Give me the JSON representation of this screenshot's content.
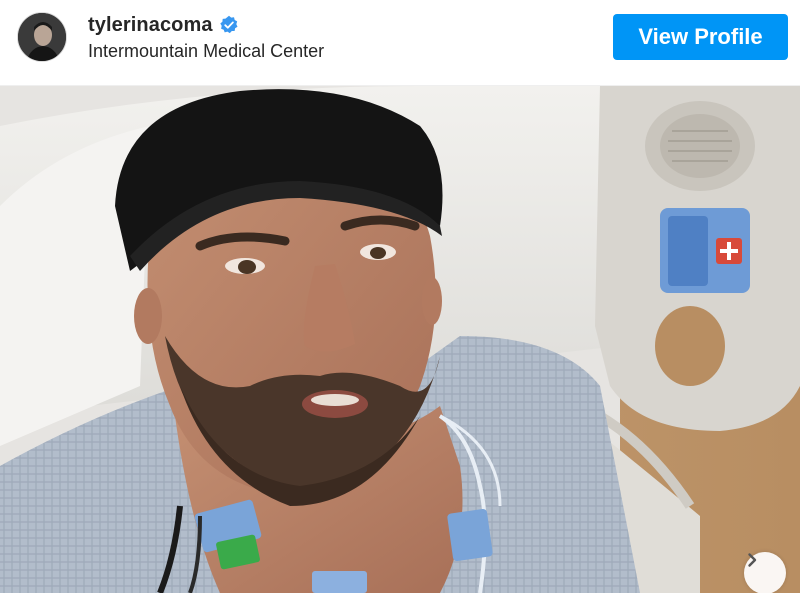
{
  "post_header": {
    "username": "tylerinacoma",
    "verified": true,
    "location": "Intermountain Medical Center",
    "view_profile_label": "View Profile"
  },
  "icons": {
    "avatar": "profile-avatar",
    "verified": "verified-badge-icon",
    "next": "chevron-right-icon"
  },
  "colors": {
    "accent": "#0095f6",
    "verified": "#3897f0",
    "text": "#262626"
  },
  "photo": {
    "alt": ""
  }
}
